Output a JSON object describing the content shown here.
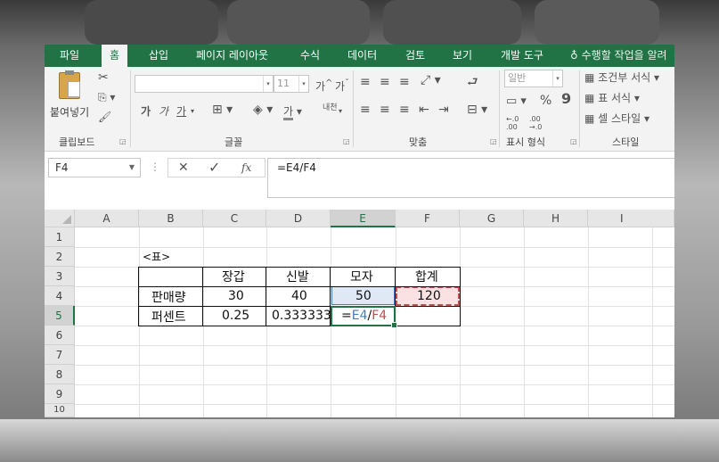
{
  "ribbon_tabs": [
    "파일",
    "홈",
    "삽입",
    "페이지 레이아웃",
    "수식",
    "데이터",
    "검토",
    "보기",
    "개발 도구"
  ],
  "tell_me": "수행할 작업을 알려",
  "clipboard": {
    "paste_label": "붙여넣기",
    "group_label": "클립보드"
  },
  "font": {
    "name": "",
    "size": "11",
    "bold": "가",
    "italic": "가",
    "underline": "가",
    "grow": "가",
    "shrink": "가",
    "color_label": "가",
    "phonetic": "내천",
    "group_label": "글꼴"
  },
  "alignment": {
    "group_label": "맞춤"
  },
  "number": {
    "format": "일반",
    "percent": "%",
    "comma": "9",
    "inc_dec": "←.0 .00",
    "dec_dec": ".00 →.0",
    "group_label": "표시 형식"
  },
  "styles": {
    "conditional": "조건부 서식",
    "table": "표 서식",
    "cell": "셀 스타일",
    "group_label": "스타일"
  },
  "formula_bar": {
    "name_box": "F4",
    "cancel": "✕",
    "enter": "✓",
    "fx": "fx",
    "formula": "=E4/F4"
  },
  "columns": [
    "A",
    "B",
    "C",
    "D",
    "E",
    "F",
    "G",
    "H",
    "I"
  ],
  "rows": [
    "1",
    "2",
    "3",
    "4",
    "5",
    "6",
    "7",
    "8",
    "9",
    "10"
  ],
  "table": {
    "caption": "<표>",
    "headers": [
      "장갑",
      "신발",
      "모자",
      "합계"
    ],
    "row_sales": {
      "label": "판매량",
      "values": [
        "30",
        "40",
        "50",
        "120"
      ]
    },
    "row_percent": {
      "label": "퍼센트",
      "values": [
        "0.25",
        "0.333333"
      ]
    },
    "editing": {
      "eq": "=",
      "ref1": "E4",
      "slash": "/",
      "ref2": "F4"
    }
  },
  "colors": {
    "ribbon_green": "#217346",
    "ref_blue": "#4a7ebb",
    "ref_red": "#c0504d"
  }
}
